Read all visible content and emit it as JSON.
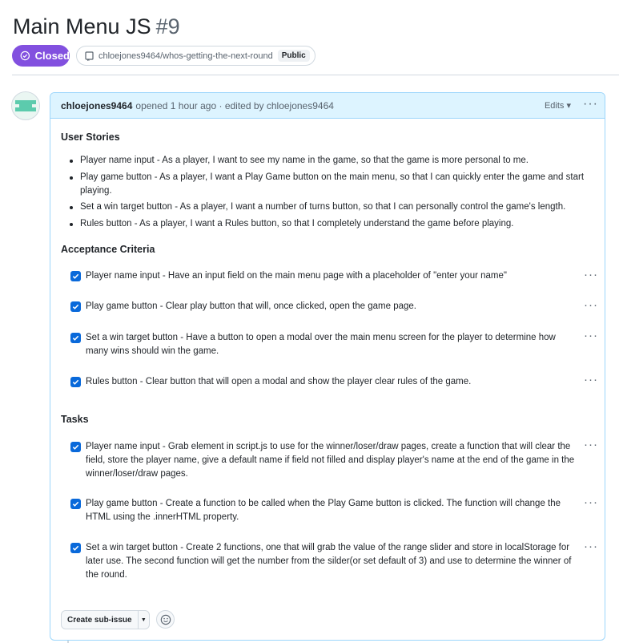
{
  "issue": {
    "title": "Main Menu JS",
    "number": "#9",
    "state": "Closed",
    "repo": "chloejones9464/whos-getting-the-next-round",
    "visibility": "Public"
  },
  "comment": {
    "author": "chloejones9464",
    "meta": "opened 1 hour ago · edited by chloejones9464",
    "edits_label": "Edits ▾",
    "more_label": "···"
  },
  "body": {
    "user_stories_heading": "User Stories",
    "user_stories": [
      "Player name input - As a player, I want to see my name in the game, so that the game is more personal to me.",
      "Play game button - As a player, I want a Play Game button on the main menu, so that I can quickly enter the game and start playing.",
      "Set a win target button - As a player, I want a number of turns button, so that I can personally control the game's length.",
      "Rules button - As a player, I want a Rules button, so that I completely understand the game before playing."
    ],
    "acceptance_heading": "Acceptance Criteria",
    "acceptance": [
      "Player name input - Have an input field on the main menu page with a placeholder of \"enter your name\"",
      "Play game button - Clear play button that will, once clicked, open the game page.",
      "Set a win target button - Have a button to open a modal over the main menu screen for the player to determine how many wins should win the game.",
      "Rules button - Clear button that will open a modal and show the player clear rules of the game."
    ],
    "tasks_heading": "Tasks",
    "tasks": [
      "Player name input - Grab element in script.js to use for the winner/loser/draw pages, create a function that will clear the field, store the player name, give a default name if field not filled and display player's name at the end of the game in the winner/loser/draw pages.",
      "Play game button - Create a function to be called when the Play Game button is clicked. The function will change the HTML using the .innerHTML property.",
      "Set a win target button - Create 2 functions, one that will grab the value of the range slider and store in localStorage for later use. The second function will get the number from the silder(or set default of 3) and use to determine the winner of the round."
    ]
  },
  "footer": {
    "create_subissue_label": "Create sub-issue"
  },
  "colors": {
    "closed_badge": "#8250df",
    "checkbox": "#0969da",
    "header_bg": "#ddf4ff",
    "header_border": "#9cd6fb"
  },
  "icons": [
    "closed-icon",
    "repo-icon",
    "avatar-icon",
    "check-icon",
    "kebab-icon",
    "caret-down-icon",
    "smiley-icon"
  ]
}
